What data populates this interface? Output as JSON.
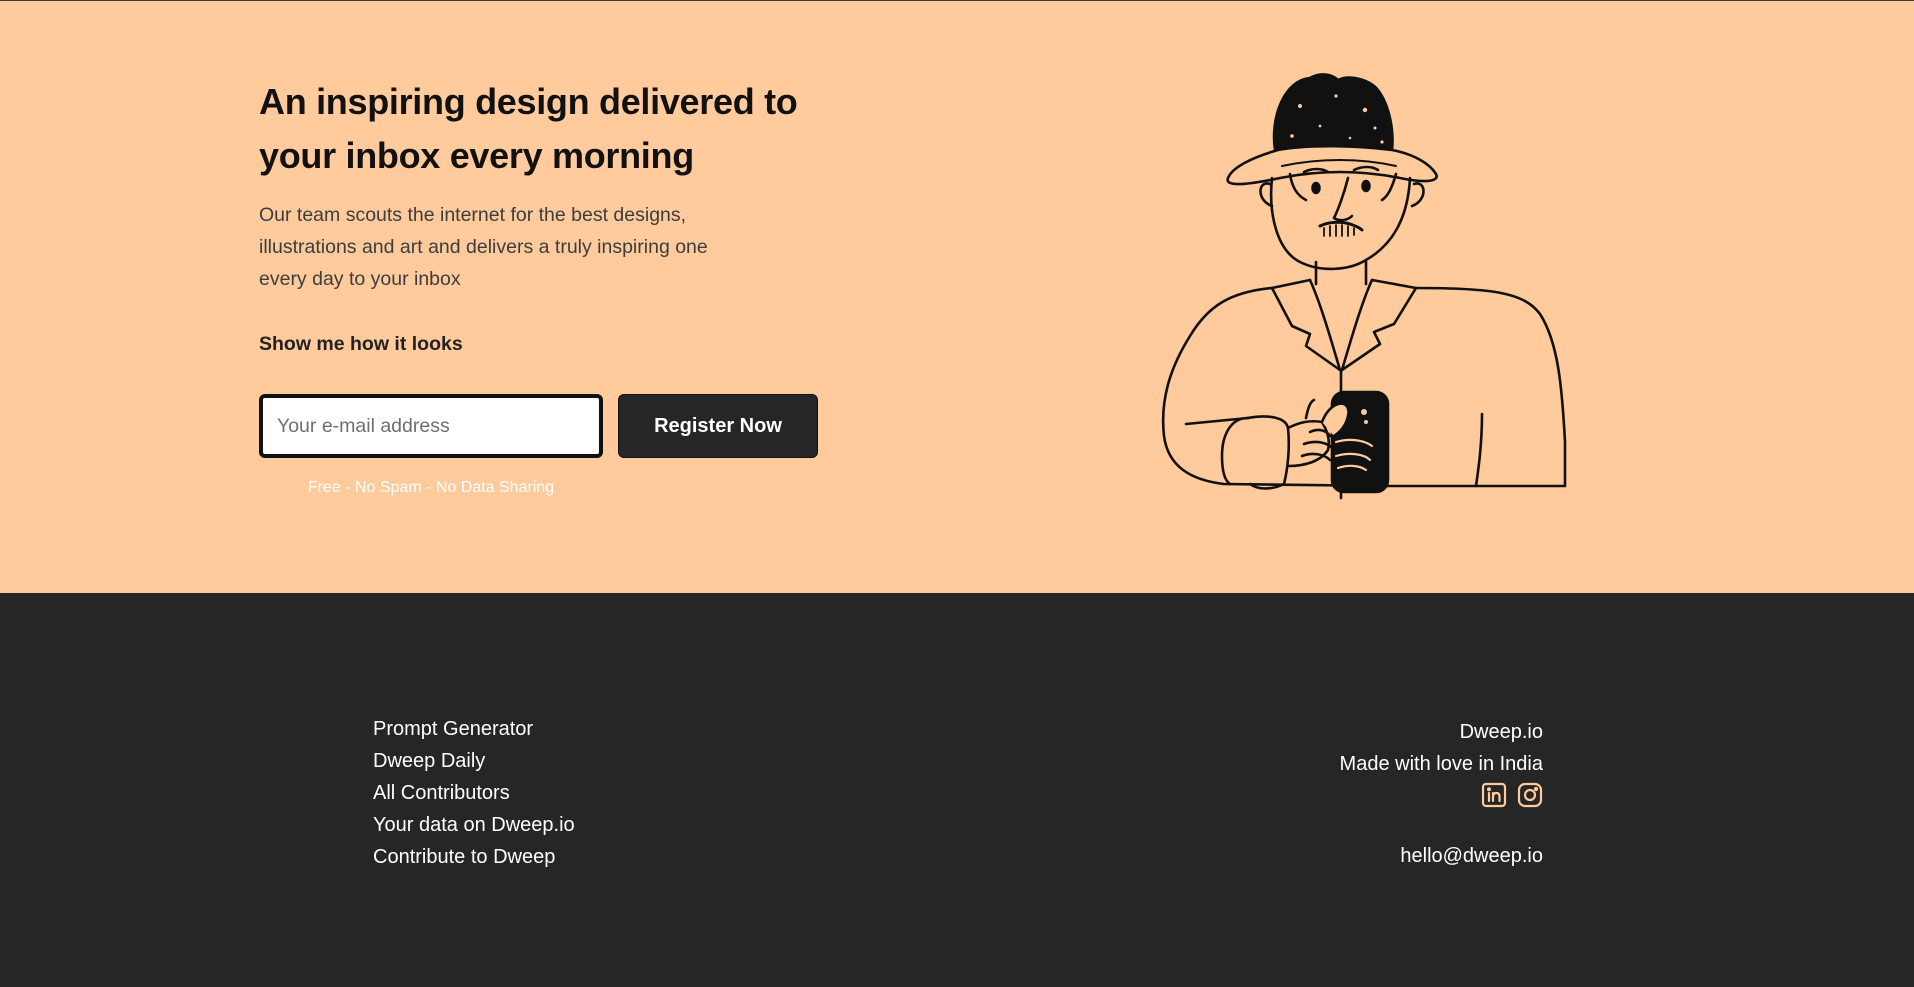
{
  "hero": {
    "headline": "An inspiring design delivered to your inbox every morning",
    "description": "Our team scouts the internet for the best designs, illustrations and art and delivers a truly inspiring one every day to your inbox",
    "preview_link": "Show me how it looks",
    "email_placeholder": "Your e-mail address",
    "register_label": "Register Now",
    "disclaimer": "Free - No Spam - No Data Sharing",
    "illustration": "man-with-hat-holding-phone",
    "background_color": "#FFCA9C"
  },
  "footer": {
    "links": [
      "Prompt Generator",
      "Dweep Daily",
      "All Contributors",
      "Your data on Dweep.io",
      "Contribute to Dweep"
    ],
    "brand": "Dweep.io",
    "tagline": "Made with love in India",
    "socials": [
      "linkedin-icon",
      "instagram-icon"
    ],
    "social_icon_color": "#FFCA9C",
    "contact_email": "hello@dweep.io",
    "background_color": "#262626"
  }
}
